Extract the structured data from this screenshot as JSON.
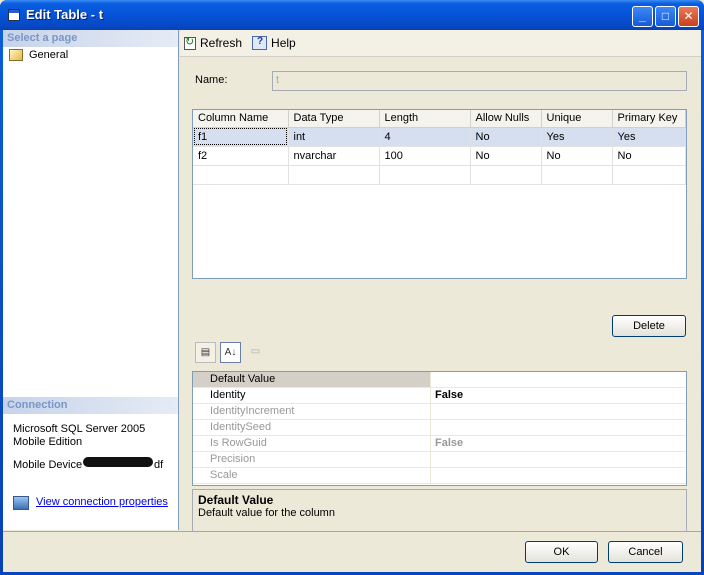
{
  "window": {
    "title": "Edit Table - t"
  },
  "left": {
    "select_page_header": "Select a page",
    "pages": [
      {
        "label": "General"
      }
    ],
    "connection_header": "Connection",
    "connection_lines": [
      "Microsoft SQL Server 2005",
      "Mobile Edition"
    ],
    "mobile_device_prefix": "Mobile Device",
    "mobile_device_suffix": "df",
    "view_connection_link": "View connection properties"
  },
  "toolbar": {
    "refresh": "Refresh",
    "help": "Help"
  },
  "form": {
    "name_label": "Name:",
    "name_value": "t"
  },
  "grid": {
    "headers": [
      "Column Name",
      "Data Type",
      "Length",
      "Allow Nulls",
      "Unique",
      "Primary Key"
    ],
    "rows": [
      [
        "f1",
        "int",
        "4",
        "No",
        "Yes",
        "Yes"
      ],
      [
        "f2",
        "nvarchar",
        "100",
        "No",
        "No",
        "No"
      ]
    ]
  },
  "buttons": {
    "delete": "Delete",
    "ok": "OK",
    "cancel": "Cancel"
  },
  "properties": {
    "rows": [
      {
        "key": "Default Value",
        "value": ""
      },
      {
        "key": "Identity",
        "value": "False"
      },
      {
        "key": "IdentityIncrement",
        "value": ""
      },
      {
        "key": "IdentitySeed",
        "value": ""
      },
      {
        "key": "Is RowGuid",
        "value": "False"
      },
      {
        "key": "Precision",
        "value": ""
      },
      {
        "key": "Scale",
        "value": ""
      }
    ]
  },
  "description": {
    "title": "Default Value",
    "text": "Default value for the column"
  }
}
